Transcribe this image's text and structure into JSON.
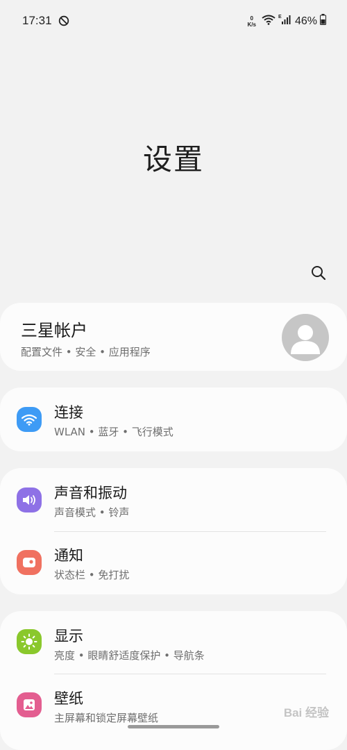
{
  "status_bar": {
    "time": "17:31",
    "net_speed_value": "0",
    "net_speed_unit": "K/s",
    "battery": "46%",
    "icons": [
      "do-not-disturb-icon",
      "wifi-icon",
      "signal-icon",
      "battery-icon"
    ]
  },
  "header": {
    "title": "设置",
    "search_icon": "search-icon"
  },
  "account": {
    "title": "三星帐户",
    "subtitle": "配置文件 • 安全 • 应用程序"
  },
  "settings": [
    {
      "id": "connect",
      "title": "连接",
      "subtitle": "WLAN • 蓝牙 • 飞行模式",
      "icon": "wifi-icon",
      "color": "#3e9bf5"
    },
    {
      "id": "sound",
      "title": "声音和振动",
      "subtitle": "声音模式 • 铃声",
      "icon": "speaker-icon",
      "color": "#8e71e6"
    },
    {
      "id": "notifications",
      "title": "通知",
      "subtitle": "状态栏 • 免打扰",
      "icon": "notification-icon",
      "color": "#f07160"
    },
    {
      "id": "display",
      "title": "显示",
      "subtitle": "亮度 • 眼睛舒适度保护 • 导航条",
      "icon": "brightness-icon",
      "color": "#8ac82c"
    },
    {
      "id": "wallpaper",
      "title": "壁纸",
      "subtitle": "主屏幕和锁定屏幕壁纸",
      "icon": "wallpaper-icon",
      "color": "#e35e90"
    }
  ],
  "watermark": "Bai 经验"
}
